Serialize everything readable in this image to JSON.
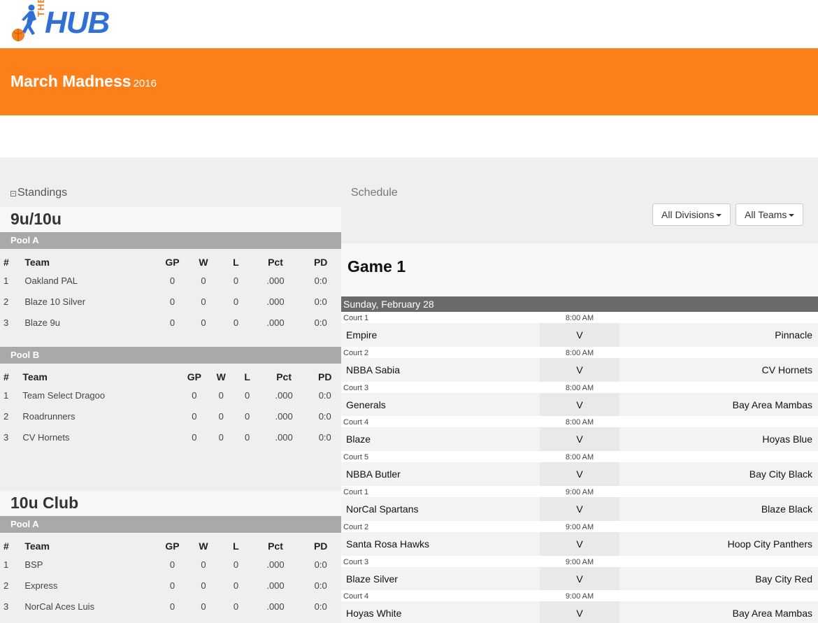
{
  "logo": {
    "the": "THE",
    "hub": "HUB"
  },
  "banner": {
    "title": "March Madness",
    "year": "2016"
  },
  "standings": {
    "heading": "Standings",
    "divisions": [
      {
        "name": "9u/10u",
        "pools": [
          {
            "name": "Pool A",
            "headers": [
              "#",
              "Team",
              "GP",
              "W",
              "L",
              "Pct",
              "PD"
            ],
            "rows": [
              [
                "1",
                "Oakland PAL",
                "0",
                "0",
                "0",
                ".000",
                "0:0"
              ],
              [
                "2",
                "Blaze 10 Silver",
                "0",
                "0",
                "0",
                ".000",
                "0:0"
              ],
              [
                "3",
                "Blaze 9u",
                "0",
                "0",
                "0",
                ".000",
                "0:0"
              ]
            ]
          },
          {
            "name": "Pool B",
            "headers": [
              "#",
              "Team",
              "GP",
              "W",
              "L",
              "Pct",
              "PD"
            ],
            "rows": [
              [
                "1",
                "Team Select Dragoo",
                "0",
                "0",
                "0",
                ".000",
                "0:0"
              ],
              [
                "2",
                "Roadrunners",
                "0",
                "0",
                "0",
                ".000",
                "0:0"
              ],
              [
                "3",
                "CV Hornets",
                "0",
                "0",
                "0",
                ".000",
                "0:0"
              ]
            ]
          }
        ]
      },
      {
        "name": "10u Club",
        "pools": [
          {
            "name": "Pool A",
            "headers": [
              "#",
              "Team",
              "GP",
              "W",
              "L",
              "Pct",
              "PD"
            ],
            "rows": [
              [
                "1",
                "BSP",
                "0",
                "0",
                "0",
                ".000",
                "0:0"
              ],
              [
                "2",
                "Express",
                "0",
                "0",
                "0",
                ".000",
                "0:0"
              ],
              [
                "3",
                "NorCal Aces Luis",
                "0",
                "0",
                "0",
                ".000",
                "0:0"
              ]
            ]
          }
        ]
      }
    ]
  },
  "schedule": {
    "heading": "Schedule",
    "divisions_dropdown": "All Divisions",
    "teams_dropdown": "All Teams",
    "game_title": "Game 1",
    "date": "Sunday, February 28",
    "vs_label": "V",
    "games": [
      {
        "court": "Court 1",
        "time": "8:00 AM",
        "home": "Empire",
        "away": "Pinnacle"
      },
      {
        "court": "Court 2",
        "time": "8:00 AM",
        "home": "NBBA Sabia",
        "away": "CV Hornets"
      },
      {
        "court": "Court 3",
        "time": "8:00 AM",
        "home": "Generals",
        "away": "Bay Area Mambas"
      },
      {
        "court": "Court 4",
        "time": "8:00 AM",
        "home": "Blaze",
        "away": "Hoyas Blue"
      },
      {
        "court": "Court 5",
        "time": "8:00 AM",
        "home": "NBBA Butler",
        "away": "Bay City Black"
      },
      {
        "court": "Court 1",
        "time": "9:00 AM",
        "home": "NorCal Spartans",
        "away": "Blaze Black"
      },
      {
        "court": "Court 2",
        "time": "9:00 AM",
        "home": "Santa Rosa Hawks",
        "away": "Hoop City Panthers"
      },
      {
        "court": "Court 3",
        "time": "9:00 AM",
        "home": "Blaze Silver",
        "away": "Bay City Red"
      },
      {
        "court": "Court 4",
        "time": "9:00 AM",
        "home": "Hoyas White",
        "away": "Bay Area Mambas"
      }
    ]
  },
  "colors": {
    "accent": "#fd7f1a",
    "brand_blue": "#2f6fd6",
    "pool_bar": "#a9a9a9",
    "date_bar": "#6b6b6b"
  }
}
